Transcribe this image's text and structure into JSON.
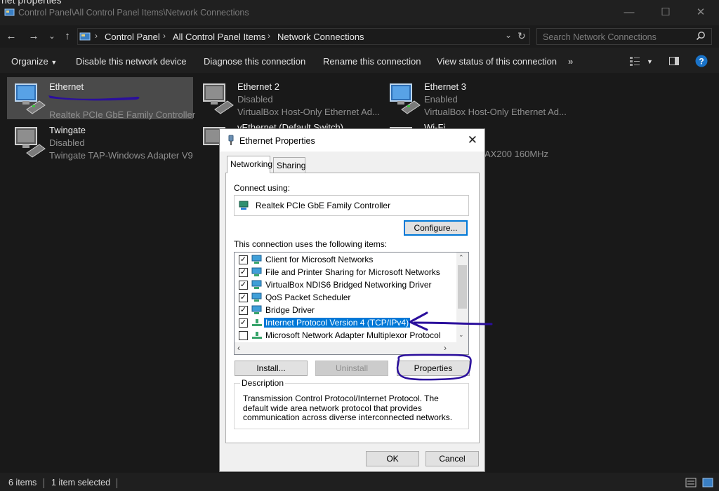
{
  "window": {
    "title": "Control Panel\\All Control Panel Items\\Network Connections",
    "ghost_text": "net properties"
  },
  "address": {
    "crumbs": [
      "Control Panel",
      "All Control Panel Items",
      "Network Connections"
    ],
    "search_placeholder": "Search Network Connections"
  },
  "commands": {
    "organize": "Organize",
    "disable": "Disable this network device",
    "diagnose": "Diagnose this connection",
    "rename": "Rename this connection",
    "view_status": "View status of this connection",
    "more": "»"
  },
  "connections": [
    {
      "name": "Ethernet",
      "status": "",
      "adapter": "Realtek PCIe GbE Family Controller"
    },
    {
      "name": "Ethernet 2",
      "status": "Disabled",
      "adapter": "VirtualBox Host-Only Ethernet Ad..."
    },
    {
      "name": "Ethernet 3",
      "status": "Enabled",
      "adapter": "VirtualBox Host-Only Ethernet Ad..."
    },
    {
      "name": "Twingate",
      "status": "Disabled",
      "adapter": "Twingate TAP-Windows Adapter V9"
    },
    {
      "name": "vEthernet (Default Switch)",
      "status": "",
      "adapter": ""
    },
    {
      "name": "Wi-Fi",
      "status": "",
      "adapter": "AX200 160MHz"
    }
  ],
  "dialog": {
    "title": "Ethernet Properties",
    "tabs": [
      "Networking",
      "Sharing"
    ],
    "connect_using_label": "Connect using:",
    "adapter": "Realtek PCIe GbE Family Controller",
    "configure_button": "Configure...",
    "items_label": "This connection uses the following items:",
    "items": [
      {
        "label": "Client for Microsoft Networks",
        "checked": true
      },
      {
        "label": "File and Printer Sharing for Microsoft Networks",
        "checked": true
      },
      {
        "label": "VirtualBox NDIS6 Bridged Networking Driver",
        "checked": true
      },
      {
        "label": "QoS Packet Scheduler",
        "checked": true
      },
      {
        "label": "Bridge Driver",
        "checked": true
      },
      {
        "label": "Internet Protocol Version 4 (TCP/IPv4)",
        "checked": true,
        "selected": true
      },
      {
        "label": "Microsoft Network Adapter Multiplexor Protocol",
        "checked": false
      }
    ],
    "install_button": "Install...",
    "uninstall_button": "Uninstall",
    "properties_button": "Properties",
    "description_heading": "Description",
    "description": "Transmission Control Protocol/Internet Protocol. The default wide area network protocol that provides communication across diverse interconnected networks.",
    "ok_button": "OK",
    "cancel_button": "Cancel"
  },
  "status": {
    "items": "6 items",
    "selected": "1 item selected"
  },
  "colors": {
    "accent": "#0078d7",
    "annotation": "#3a1aa8"
  }
}
